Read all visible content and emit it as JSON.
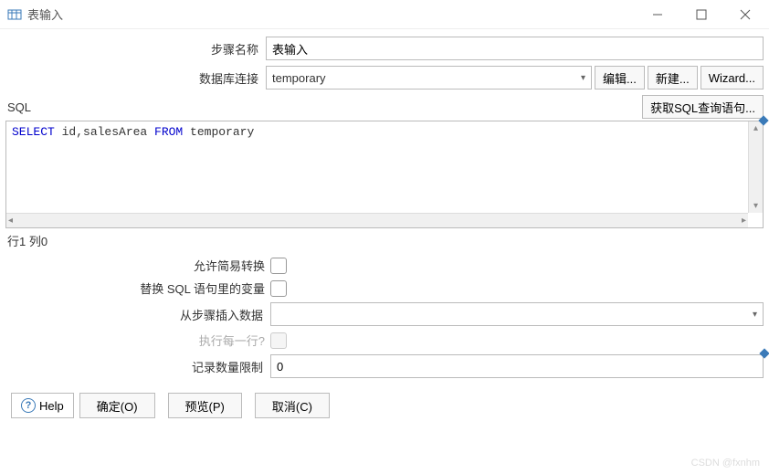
{
  "window": {
    "title": "表输入"
  },
  "form": {
    "step_name_label": "步骤名称",
    "step_name_value": "表输入",
    "db_conn_label": "数据库连接",
    "db_conn_value": "temporary",
    "edit_btn": "编辑...",
    "new_btn": "新建...",
    "wizard_btn": "Wizard..."
  },
  "sql": {
    "label": "SQL",
    "get_sql_btn": "获取SQL查询语句...",
    "kw_select": "SELECT",
    "fields": " id,salesArea ",
    "kw_from": "FROM",
    "table": " temporary",
    "status": "行1 列0"
  },
  "options": {
    "allow_simple_label": "允许简易转换",
    "replace_vars_label": "替换 SQL 语句里的变量",
    "insert_from_step_label": "从步骤插入数据",
    "insert_from_step_value": "",
    "execute_each_label": "执行每一行?",
    "limit_label": "记录数量限制",
    "limit_value": "0"
  },
  "footer": {
    "help": "Help",
    "ok": "确定(O)",
    "preview": "预览(P)",
    "cancel": "取消(C)"
  },
  "watermark": "CSDN @fxnhm"
}
